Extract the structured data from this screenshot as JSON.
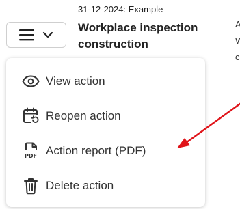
{
  "item": {
    "date_label": "31-12-2024: Example",
    "title": "Workplace inspection construction"
  },
  "side_column": {
    "lines": [
      "A",
      "W",
      "c"
    ]
  },
  "dropdown": {
    "items": [
      {
        "label": "View action",
        "icon": "eye-icon"
      },
      {
        "label": "Reopen action",
        "icon": "calendar-refresh-icon"
      },
      {
        "label": "Action report (PDF)",
        "icon": "pdf-file-icon"
      },
      {
        "label": "Delete action",
        "icon": "trash-icon"
      }
    ]
  },
  "colors": {
    "annotation_arrow": "#e0141a",
    "text": "#222222",
    "border": "#cfcfcf"
  }
}
